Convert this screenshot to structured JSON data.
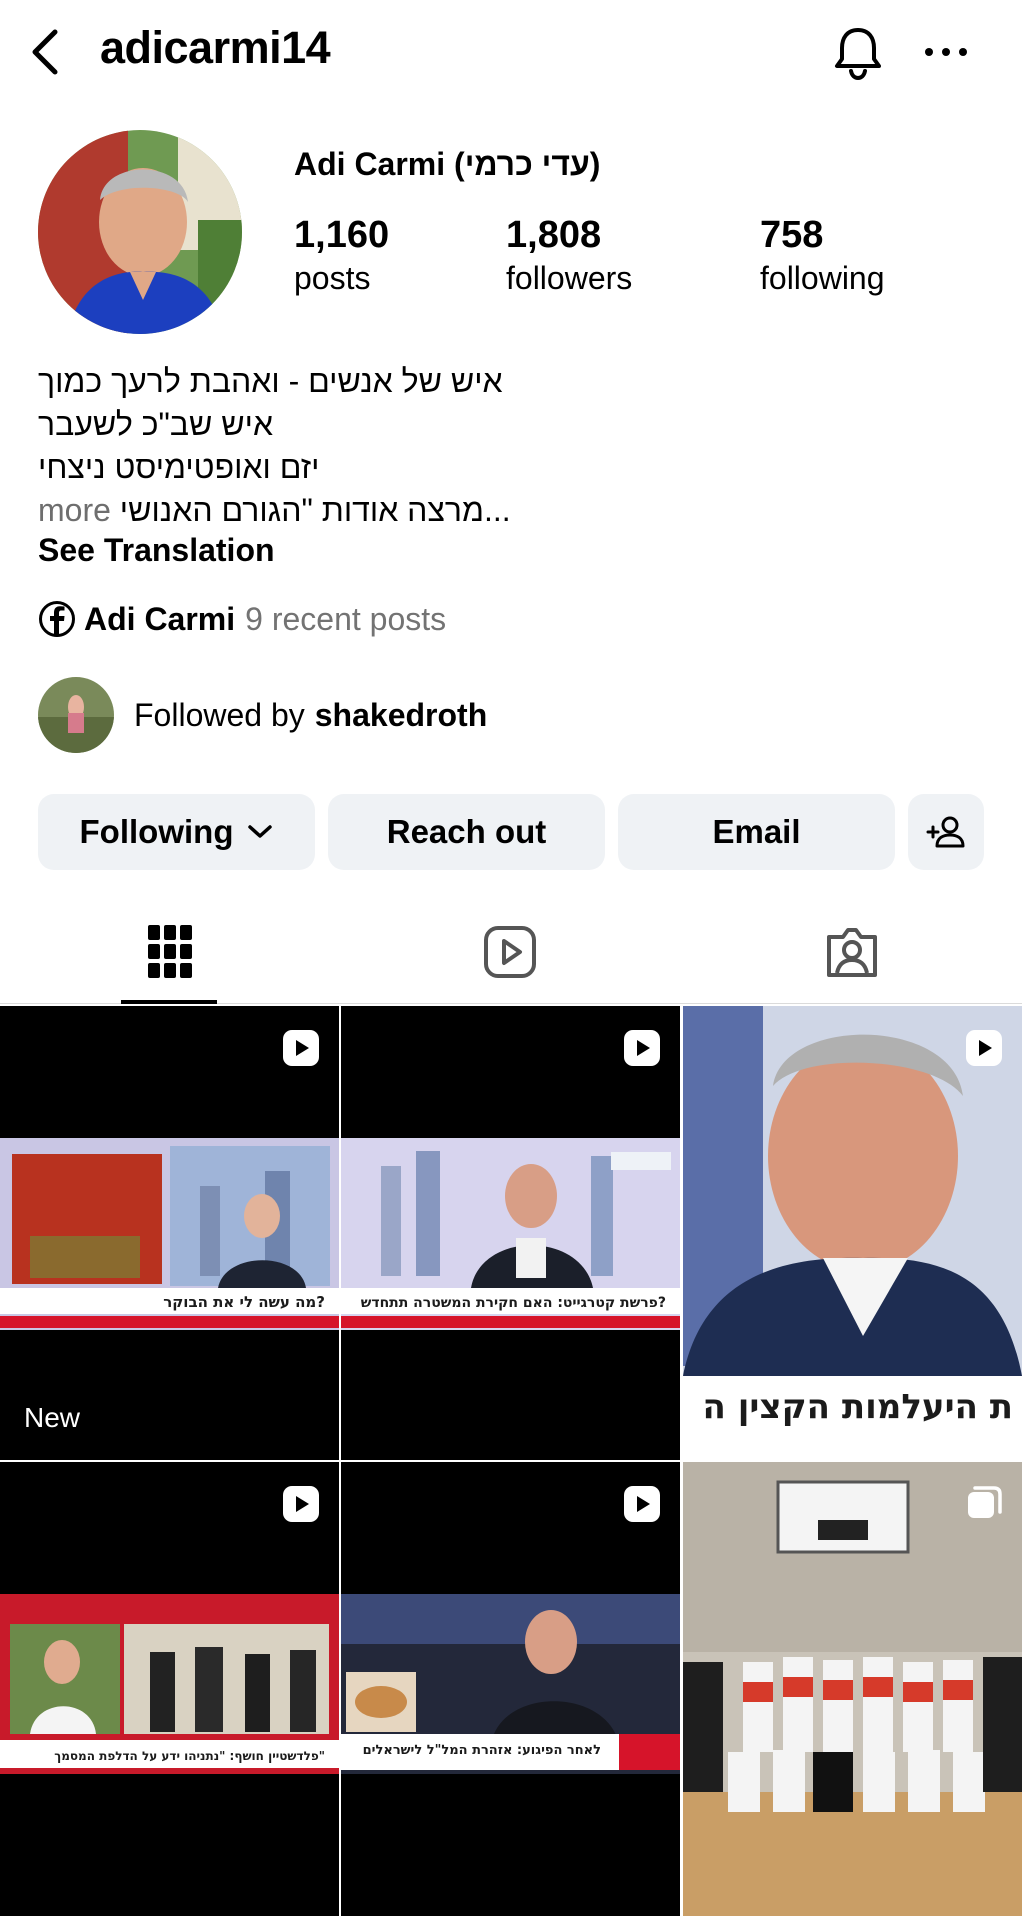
{
  "header": {
    "username": "adicarmi14"
  },
  "profile": {
    "full_name": "Adi Carmi (עדי כרמי)",
    "stats": {
      "posts_count": "1,160",
      "posts_label": "posts",
      "followers_count": "1,808",
      "followers_label": "followers",
      "following_count": "758",
      "following_label": "following"
    },
    "bio": {
      "line1": "איש של אנשים - ואהבת לרעך כמוך",
      "line2": "איש שב\"כ לשעבר",
      "line3": "יזם ואופטימיסט ניצחי",
      "line4": "מרצה אודות \"הגורם האנושי...",
      "more": "more"
    },
    "see_translation": "See Translation",
    "facebook": {
      "name": "Adi Carmi",
      "recent": "9 recent posts"
    },
    "followed_by": {
      "prefix": "Followed by",
      "name": "shakedroth"
    }
  },
  "actions": {
    "following": "Following",
    "reach_out": "Reach out",
    "email": "Email"
  },
  "tabs": [
    "grid-icon",
    "reels-icon",
    "tagged-icon"
  ],
  "posts": [
    {
      "type": "reel",
      "label": "New",
      "caption": "מה עשה לי את הבוקר?"
    },
    {
      "type": "reel",
      "caption": "פרשת קטרגייט: האם חקירת המשטרה תתחדש?"
    },
    {
      "type": "reel",
      "caption": "ת היעלמות הקצין ה"
    },
    {
      "type": "reel",
      "caption": "פלדשטיין חושף: \"נתניהו ידע על הדלפת המסמך\""
    },
    {
      "type": "reel",
      "caption": "לאחר הפיגוע: אזהרת המל\"ל לישראלים"
    },
    {
      "type": "carousel"
    }
  ],
  "colors": {
    "button_bg": "#eff2f5",
    "muted_text": "#737373",
    "news_red": "#d6142a"
  }
}
